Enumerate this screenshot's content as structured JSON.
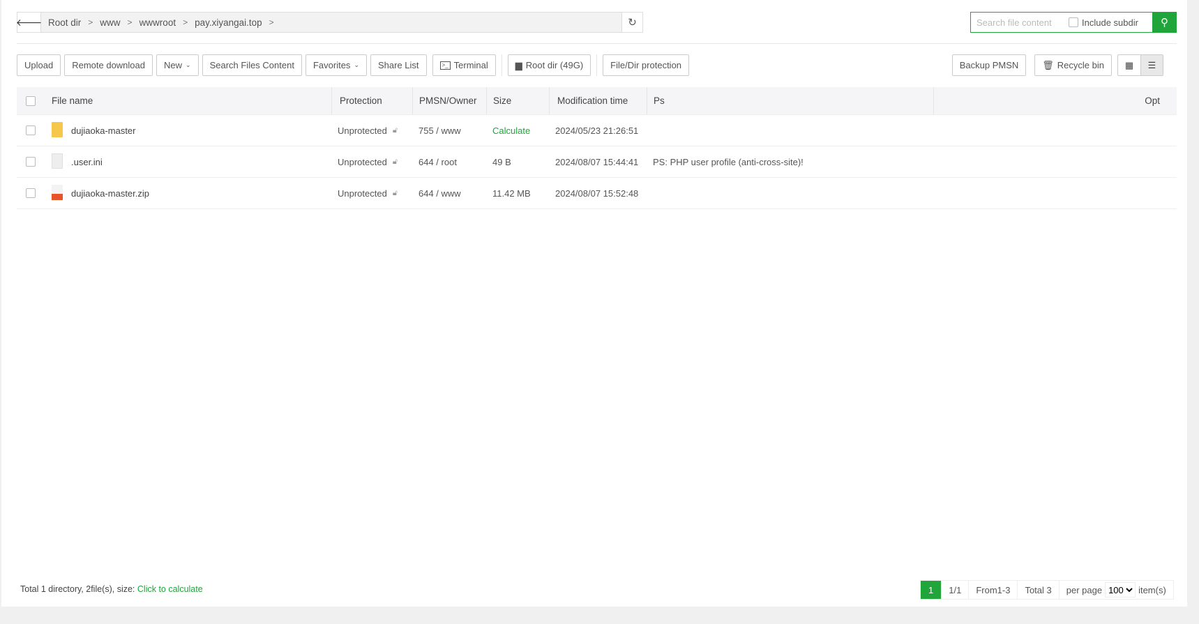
{
  "breadcrumb": {
    "items": [
      "Root dir",
      "www",
      "wwwroot",
      "pay.xiyangai.top"
    ]
  },
  "search": {
    "placeholder": "Search file content",
    "include_subdir": "Include subdir",
    "include_subdir_checked": false
  },
  "toolbar": {
    "left": [
      "Upload",
      "Remote download",
      "New",
      "Search Files Content",
      "Favorites",
      "Share List",
      "Terminal",
      "Root dir (49G)",
      "File/Dir protection"
    ],
    "right": [
      "Backup PMSN",
      "Recycle bin"
    ],
    "view_mode": "list"
  },
  "table": {
    "headers": {
      "name": "File name",
      "protection": "Protection",
      "owner": "PMSN/Owner",
      "size": "Size",
      "mtime": "Modification time",
      "ps": "Ps",
      "opt": "Opt"
    },
    "rows": [
      {
        "type": "folder",
        "name": "dujiaoka-master",
        "protection": "Unprotected",
        "owner": "755 / www",
        "size": "Calculate",
        "mtime": "2024/05/23 21:26:51",
        "ps": ""
      },
      {
        "type": "file",
        "name": ".user.ini",
        "protection": "Unprotected",
        "owner": "644 / root",
        "size": "49 B",
        "mtime": "2024/08/07 15:44:41",
        "ps": "PS: PHP user profile (anti-cross-site)!"
      },
      {
        "type": "zip",
        "name": "dujiaoka-master.zip",
        "protection": "Unprotected",
        "owner": "644 / www",
        "size": "11.42 MB",
        "mtime": "2024/08/07 15:52:48",
        "ps": ""
      }
    ]
  },
  "footer": {
    "summary": "Total 1 directory, 2file(s), size:",
    "calc_link": "Click to calculate"
  },
  "pager": {
    "current": "1",
    "pages": "1/1",
    "range": "From1-3",
    "total": "Total 3",
    "per_page_label": "per page",
    "per_page": "100",
    "items_label": "item(s)"
  },
  "colors": {
    "accent": "#20a53a"
  }
}
